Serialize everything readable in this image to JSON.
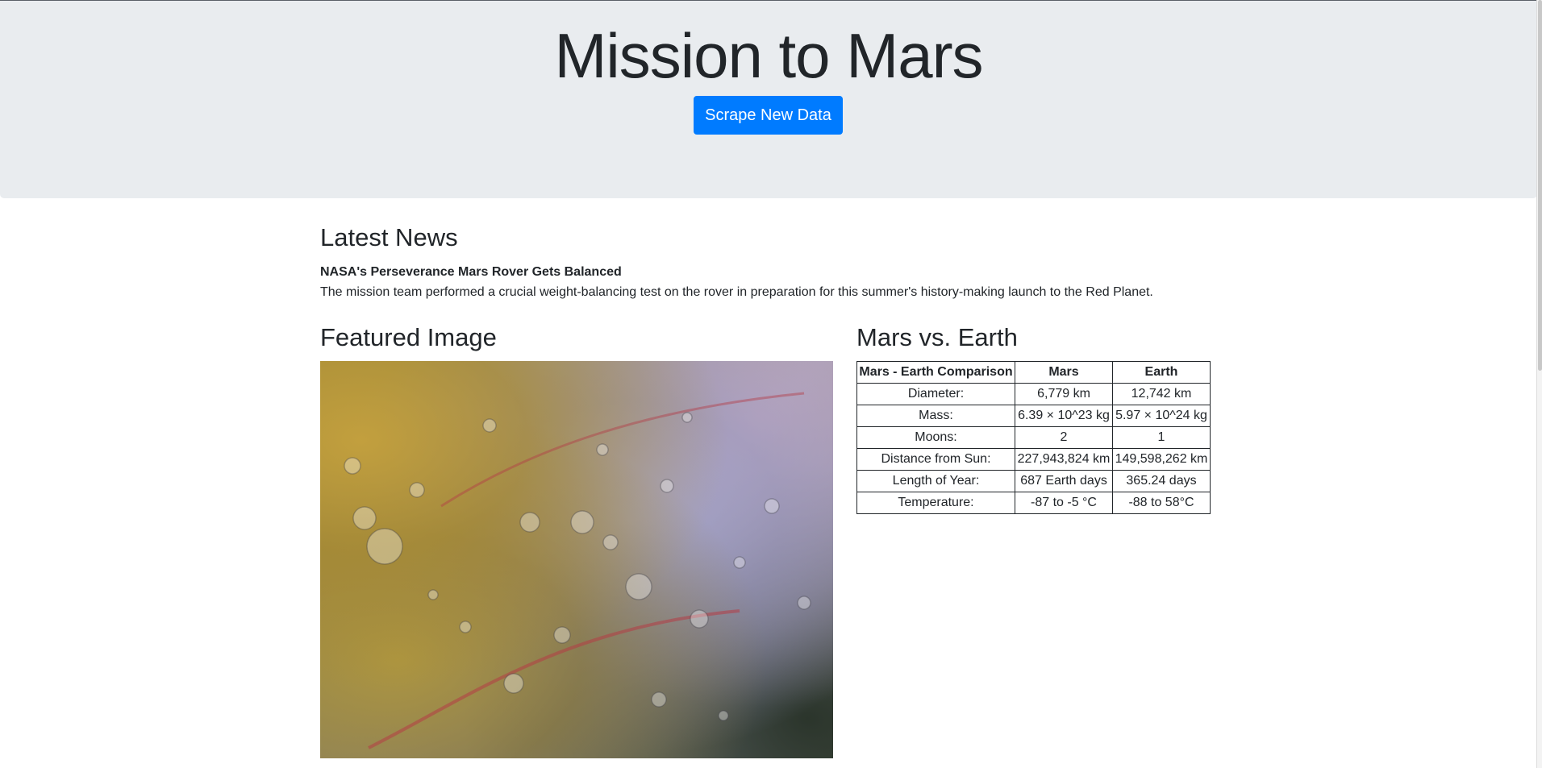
{
  "header": {
    "title": "Mission to Mars",
    "scrape_button_label": "Scrape New Data"
  },
  "news": {
    "heading": "Latest News",
    "title": "NASA's Perseverance Mars Rover Gets Balanced",
    "paragraph": "The mission team performed a crucial weight-balancing test on the rover in preparation for this summer's history-making launch to the Red Planet."
  },
  "featured_image": {
    "heading": "Featured Image"
  },
  "facts": {
    "heading": "Mars vs. Earth",
    "columns": [
      "Mars - Earth Comparison",
      "Mars",
      "Earth"
    ],
    "rows": [
      [
        "Diameter:",
        "6,779 km",
        "12,742 km"
      ],
      [
        "Mass:",
        "6.39 × 10^23 kg",
        "5.97 × 10^24 kg"
      ],
      [
        "Moons:",
        "2",
        "1"
      ],
      [
        "Distance from Sun:",
        "227,943,824 km",
        "149,598,262 km"
      ],
      [
        "Length of Year:",
        "687 Earth days",
        "365.24 days"
      ],
      [
        "Temperature:",
        "-87 to -5 °C",
        "-88 to 58°C"
      ]
    ]
  },
  "colors": {
    "jumbotron_bg": "#e9ecef",
    "button_primary": "#007bff",
    "text": "#212529"
  }
}
